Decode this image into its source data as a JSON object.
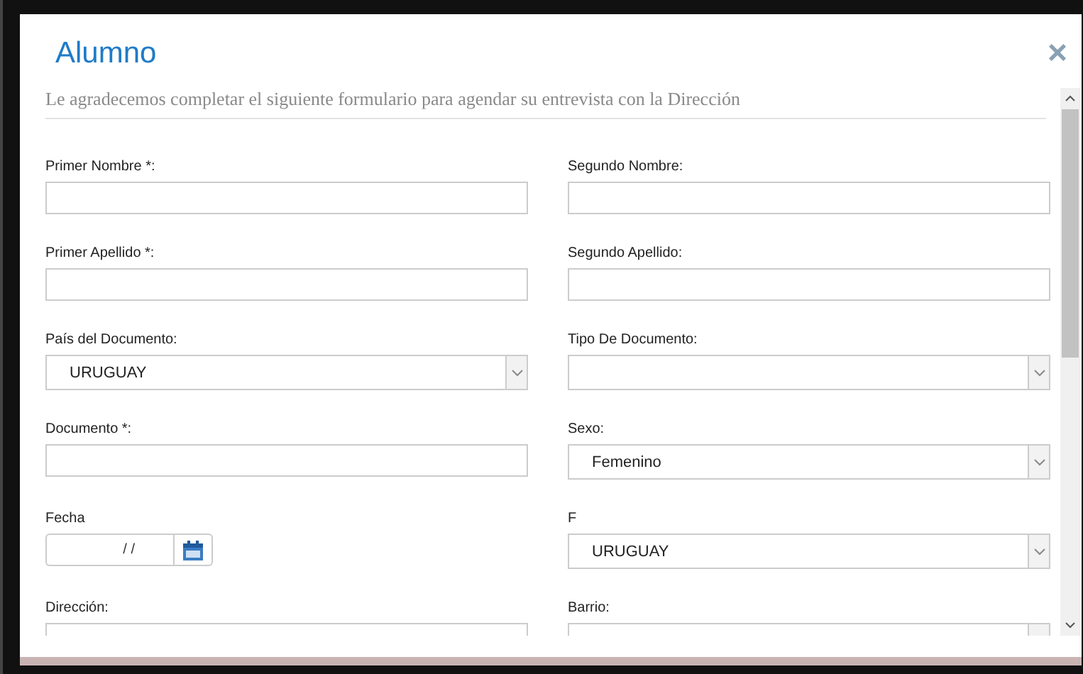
{
  "dialog": {
    "title": "Alumno",
    "close": "×",
    "subtitle": "Le agradecemos completar el siguiente formulario para agendar su entrevista con la Dirección"
  },
  "fields": [
    {
      "kind": "text",
      "label": "Primer Nombre *:"
    },
    {
      "kind": "text",
      "label": "Segundo Nombre:"
    },
    {
      "kind": "text",
      "label": "Primer Apellido *:"
    },
    {
      "kind": "text",
      "label": "Segundo Apellido:"
    },
    {
      "kind": "select",
      "label": "País del Documento:",
      "value": "URUGUAY"
    },
    {
      "kind": "select",
      "label": "Tipo De Documento:"
    },
    {
      "kind": "text",
      "label": "Documento *:"
    },
    {
      "kind": "select",
      "label": "Sexo:",
      "value": "Femenino"
    },
    {
      "kind": "date",
      "label": "Fecha",
      "value": "/ /"
    },
    {
      "kind": "select",
      "label": "F",
      "value": "URUGUAY"
    },
    {
      "kind": "text",
      "label": "Dirección:"
    },
    {
      "kind": "select",
      "label": "Barrio:"
    }
  ]
}
